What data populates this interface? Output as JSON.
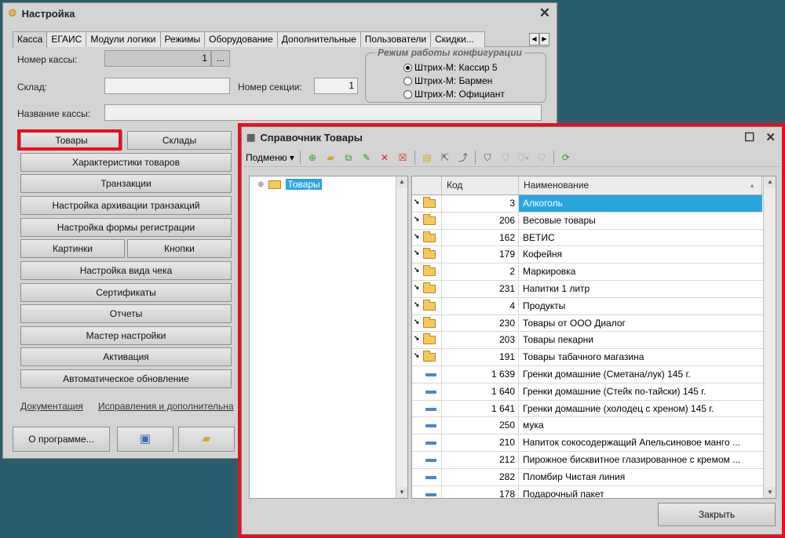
{
  "settings_window": {
    "title": "Настройка",
    "close": "✕",
    "tabs": [
      "Касса",
      "ЕГАИС",
      "Модули логики",
      "Режимы",
      "Оборудование",
      "Дополнительные",
      "Пользователи",
      "Скидки..."
    ],
    "fields": {
      "register_number_label": "Номер кассы:",
      "register_number_value": "1",
      "register_number_btn": "...",
      "warehouse_label": "Склад:",
      "section_number_label": "Номер секции:",
      "section_number_value": "1",
      "register_name_label": "Название кассы:"
    },
    "mode_group": {
      "legend": "Режим работы конфигурации",
      "options": [
        "Штрих-М: Кассир 5",
        "Штрих-М: Бармен",
        "Штрих-М: Официант"
      ],
      "selected": 0
    },
    "buttons": {
      "goods": "Товары",
      "warehouses": "Склады",
      "characteristics": "Характеристики товаров",
      "transactions": "Транзакции",
      "archive": "Настройка архивации транзакций",
      "reg_form": "Настройка формы регистрации",
      "pictures": "Картинки",
      "buttons": "Кнопки",
      "receipt": "Настройка вида чека",
      "certificates": "Сертификаты",
      "reports": "Отчеты",
      "wizard": "Мастер настройки",
      "activation": "Активация",
      "autoupdate": "Автоматическое обновление",
      "about": "О программе..."
    },
    "links": {
      "docs": "Документация",
      "fixes": "Исправления и дополнительна"
    }
  },
  "catalog_window": {
    "title": "Справочник Товары",
    "toolbar": {
      "menu": "Подменю"
    },
    "tree_root": "Товары",
    "columns": {
      "code": "Код",
      "name": "Наименование"
    },
    "rows": [
      {
        "kind": "folder",
        "code": "3",
        "name": "Алкоголь"
      },
      {
        "kind": "folder",
        "code": "206",
        "name": "Весовые товары"
      },
      {
        "kind": "folder",
        "code": "162",
        "name": "ВЕТИС"
      },
      {
        "kind": "folder",
        "code": "179",
        "name": "Кофейня"
      },
      {
        "kind": "folder",
        "code": "2",
        "name": "Маркировка"
      },
      {
        "kind": "folder",
        "code": "231",
        "name": "Напитки 1 литр"
      },
      {
        "kind": "folder",
        "code": "4",
        "name": "Продукты"
      },
      {
        "kind": "folder",
        "code": "230",
        "name": "Товары от ООО Диалог"
      },
      {
        "kind": "folder",
        "code": "203",
        "name": "Товары пекарни"
      },
      {
        "kind": "folder",
        "code": "191",
        "name": "Товары табачного магазина"
      },
      {
        "kind": "item",
        "code": "1 639",
        "name": "Гренки домашние (Сметана/лук) 145 г."
      },
      {
        "kind": "item",
        "code": "1 640",
        "name": "Гренки домашние (Стейк по-тайски) 145 г."
      },
      {
        "kind": "item",
        "code": "1 641",
        "name": "Гренки домашние (холодец с хреном) 145 г."
      },
      {
        "kind": "item",
        "code": "250",
        "name": "мука"
      },
      {
        "kind": "item",
        "code": "210",
        "name": "Напиток сокосодержащий Апельсиновое манго ..."
      },
      {
        "kind": "item",
        "code": "212",
        "name": "Пирожное бисквитное глазированное с кремом ..."
      },
      {
        "kind": "item",
        "code": "282",
        "name": "Пломбир Чистая линия"
      },
      {
        "kind": "item",
        "code": "178",
        "name": "Подарочный пакет"
      }
    ],
    "close_button": "Закрыть"
  },
  "colors": {
    "highlight": "#e8101e",
    "selection": "#29a6de"
  }
}
